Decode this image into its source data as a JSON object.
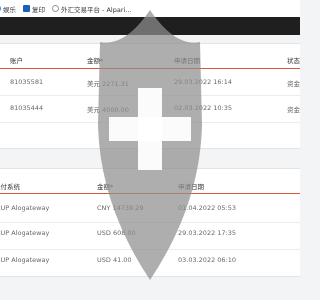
{
  "bookmarks": [
    {
      "label": "娱乐",
      "icon": "folder-icon"
    },
    {
      "label": "复印",
      "icon": "bookmark-icon"
    },
    {
      "label": "外汇交易平台 - Alpari...",
      "icon": "page-icon"
    }
  ],
  "accounts_table": {
    "columns": [
      "账户",
      "金额",
      "申请日期",
      "状态"
    ],
    "sort_marker": "*",
    "rows": [
      {
        "account": "81035581",
        "amount": "美元 2271.31",
        "date": "29.03.2022 16:14",
        "status": "资金"
      },
      {
        "account": "81035444",
        "amount": "美元 4000.00",
        "date": "02.03.2022 10:35",
        "status": "资金"
      }
    ]
  },
  "payments_table": {
    "columns": [
      "支付系统",
      "金额",
      "申请日期"
    ],
    "sort_marker": "*",
    "rows": [
      {
        "system": "CUP Alogateway",
        "amount": "CNY 14739.29",
        "date": "01.04.2022 05:53"
      },
      {
        "system": "CUP Alogateway",
        "amount": "USD 608.00",
        "date": "29.03.2022 17:35"
      },
      {
        "system": "CUP Alogateway",
        "amount": "USD 41.00",
        "date": "03.03.2022 06:10"
      }
    ]
  },
  "colors": {
    "header_rule": "#d9583a",
    "overlay": "#8f8f8f"
  }
}
